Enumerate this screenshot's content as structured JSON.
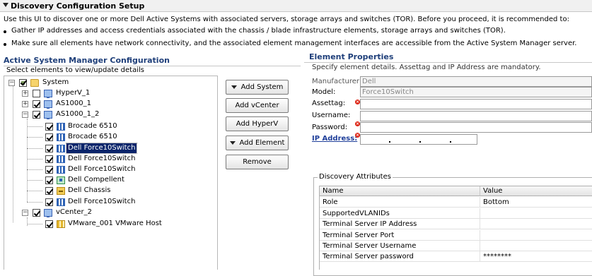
{
  "header": {
    "title": "Discovery Configuration Setup",
    "intro": "Use this UI to discover one or more Dell Active Systems with associated servers, storage arrays and switches (TOR). Before you proceed, it is recommended to:",
    "bullets": [
      "Gather IP addresses and access credentials associated with the chassis / blade infrastructure elements, storage arrays and switches (TOR).",
      "Make sure all elements have network connectivity, and the associated element management interfaces are accessible from the Active System Manager server."
    ]
  },
  "asm": {
    "title": "Active System Manager Configuration",
    "subtitle": "Select elements to view/update details"
  },
  "tree": {
    "root": "System",
    "items": [
      "HyperV_1",
      "AS1000_1",
      "AS1000_1_2",
      "Brocade 6510",
      "Brocade 6510",
      "Dell Force10Switch",
      "Dell Force10Switch",
      "Dell Force10Switch",
      "Dell Compellent",
      "Dell Chassis",
      "Dell Force10Switch",
      "vCenter_2",
      "VMware_001 VMware Host"
    ]
  },
  "buttons": {
    "add_system": "Add System",
    "add_vcenter": "Add vCenter",
    "add_hyperv": "Add HyperV",
    "add_element": "Add Element",
    "remove": "Remove"
  },
  "props": {
    "title": "Element Properties",
    "subtitle": "Specify element details. Assettag and IP Address are mandatory.",
    "manufacturer_label": "Manufacturer:",
    "manufacturer_value": "Dell",
    "model_label": "Model:",
    "model_value": "Force10Switch",
    "assettag_label": "Assettag:",
    "username_label": "Username:",
    "password_label": "Password:",
    "ip_label": "IP Address:"
  },
  "discovery": {
    "title": "Discovery Attributes",
    "columns": [
      "Name",
      "Value"
    ],
    "rows": [
      {
        "name": "Role",
        "value": "Bottom"
      },
      {
        "name": "SupportedVLANIDs",
        "value": ""
      },
      {
        "name": "Terminal Server IP Address",
        "value": ""
      },
      {
        "name": "Terminal Server Port",
        "value": ""
      },
      {
        "name": "Terminal Server Username",
        "value": ""
      },
      {
        "name": "Terminal Server password",
        "value": "********"
      }
    ]
  }
}
